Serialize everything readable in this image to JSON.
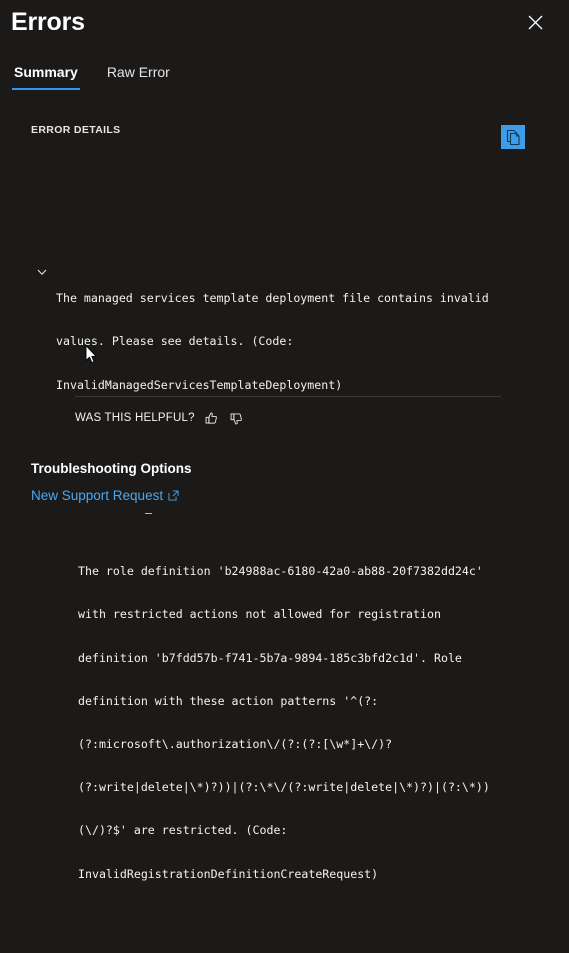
{
  "panel": {
    "title": "Errors",
    "close_label": "Close",
    "background": "#1b1a19",
    "accent": "#2899f5"
  },
  "tabs": [
    {
      "label": "Summary",
      "active": true
    },
    {
      "label": "Raw Error",
      "active": false
    }
  ],
  "error_details": {
    "section_label": "ERROR DETAILS",
    "copy_button_label": "Copy error",
    "copy_button_color": "#3c9de8",
    "expand_state": "expanded",
    "primary": {
      "lines": [
        "The managed services template deployment file contains invalid",
        "values. Please see details. (Code:",
        "InvalidManagedServicesTemplateDeployment)"
      ]
    },
    "secondary": {
      "lines": [
        "The role definition 'b24988ac-6180-42a0-ab88-20f7382dd24c'",
        "with restricted actions not allowed for registration",
        "definition 'b7fdd57b-f741-5b7a-9894-185c3bfd2c1d'. Role",
        "definition with these action patterns '^(?:",
        "(?:microsoft\\.authorization\\/(?:(?:[\\w*]+\\/)?",
        "(?:write|delete|\\*)?))|(?:\\*\\/(?:write|delete|\\*)?)|(?:\\*))",
        "(\\/)?$' are restricted. (Code:",
        "InvalidRegistrationDefinitionCreateRequest)"
      ]
    }
  },
  "feedback": {
    "question": "WAS THIS HELPFUL?",
    "thumbs_up_label": "Yes",
    "thumbs_down_label": "No"
  },
  "troubleshooting": {
    "heading": "Troubleshooting Options",
    "link_label": "New Support Request",
    "link_color": "#4aa7f0"
  }
}
